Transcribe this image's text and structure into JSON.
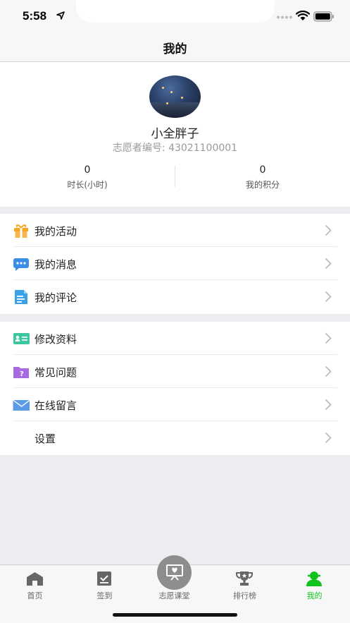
{
  "status_bar": {
    "time": "5:58"
  },
  "nav": {
    "title": "我的"
  },
  "profile": {
    "username": "小全胖子",
    "volunteer_no": "志愿者编号: 43021100001",
    "stats": [
      {
        "value": "0",
        "label": "时长(小时)"
      },
      {
        "value": "0",
        "label": "我的积分"
      }
    ]
  },
  "menu_group_1": [
    {
      "label": "我的活动",
      "icon": "gift-icon"
    },
    {
      "label": "我的消息",
      "icon": "chat-bubble-icon"
    },
    {
      "label": "我的评论",
      "icon": "document-icon"
    }
  ],
  "menu_group_2": [
    {
      "label": "修改资料",
      "icon": "id-card-icon"
    },
    {
      "label": "常见问题",
      "icon": "question-folder-icon"
    },
    {
      "label": "在线留言",
      "icon": "envelope-icon"
    },
    {
      "label": "设置",
      "icon": ""
    }
  ],
  "tabs": [
    {
      "label": "首页",
      "icon": "home-icon"
    },
    {
      "label": "签到",
      "icon": "check-in-icon"
    },
    {
      "label": "志愿课堂",
      "icon": "classroom-board-icon"
    },
    {
      "label": "排行榜",
      "icon": "trophy-icon"
    },
    {
      "label": "我的",
      "icon": "user-icon",
      "active": true
    }
  ],
  "colors": {
    "active_tab": "#10c21e",
    "page_bg": "#ecedf1"
  }
}
